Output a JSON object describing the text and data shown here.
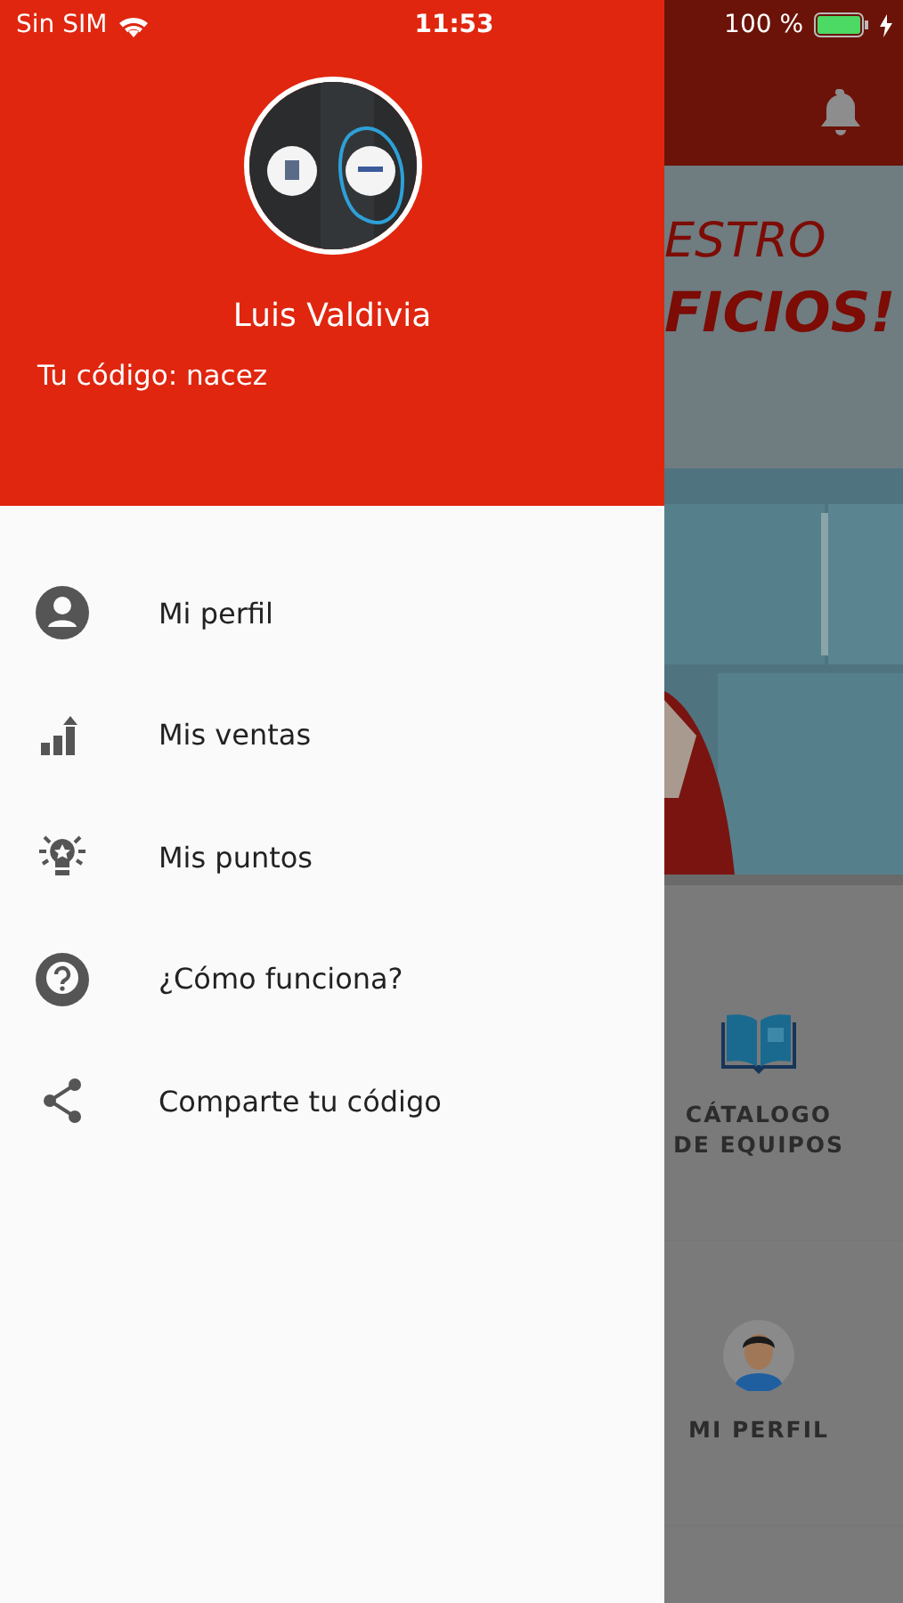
{
  "status_bar": {
    "carrier": "Sin SIM",
    "time": "11:53",
    "battery": "100 %"
  },
  "drawer": {
    "name": "Luis Valdivia",
    "code_line": "Tu código: nacez",
    "menu": [
      {
        "label": "Mi perfil"
      },
      {
        "label": "Mis ventas"
      },
      {
        "label": "Mis puntos"
      },
      {
        "label": "¿Cómo funciona?"
      },
      {
        "label": "Comparte tu código"
      }
    ]
  },
  "background_page": {
    "banner": {
      "headline": [
        "ESTRO",
        "FICIOS!"
      ]
    },
    "tiles": [
      {
        "label": "CÁTALOGO DE EQUIPOS"
      },
      {
        "label": "MI PERFIL"
      }
    ]
  }
}
